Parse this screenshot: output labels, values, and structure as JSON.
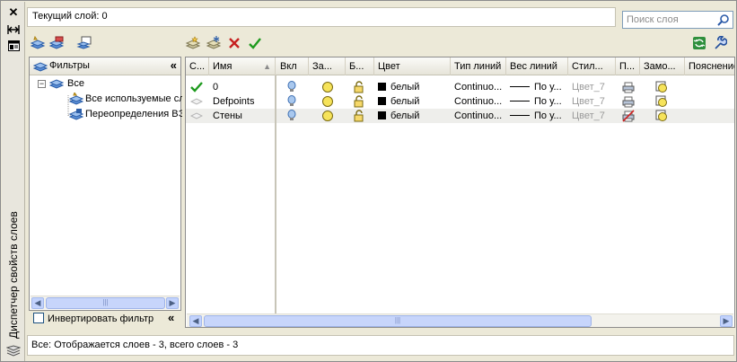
{
  "palette_title": "Диспетчер свойств слоев",
  "current_layer": "Текущий слой: 0",
  "search": {
    "placeholder": "Поиск слоя"
  },
  "filters": {
    "header": "Фильтры",
    "tree": [
      {
        "label": "Все",
        "level": 0
      },
      {
        "label": "Все используемые сл",
        "level": 1
      },
      {
        "label": "Переопределения ВЭ",
        "level": 1
      }
    ],
    "invert_label": "Инвертировать фильтр"
  },
  "columns": [
    "С...",
    "Имя",
    "Вкл",
    "За...",
    "Б...",
    "Цвет",
    "Тип линий",
    "Вес линий",
    "Стил...",
    "П...",
    "Замо...",
    "Пояснение"
  ],
  "layers": [
    {
      "name": "0",
      "current": true,
      "color": "белый",
      "linetype": "Continuo...",
      "lineweight": "По у...",
      "plot_style": "Цвет_7",
      "plot": true
    },
    {
      "name": "Defpoints",
      "current": false,
      "color": "белый",
      "linetype": "Continuo...",
      "lineweight": "По у...",
      "plot_style": "Цвет_7",
      "plot": true
    },
    {
      "name": "Стены",
      "current": false,
      "color": "белый",
      "linetype": "Continuo...",
      "lineweight": "По у...",
      "plot_style": "Цвет_7",
      "plot": false
    }
  ],
  "status": "Все: Отображается слоев - 3, всего слоев - 3",
  "scroll_grip": "|||",
  "icons": {
    "close": "close-icon",
    "auto_hide": "auto-hide-icon",
    "properties": "properties-icon",
    "new_property_filter": "new-property-filter-icon",
    "new_group_filter": "new-group-filter-icon",
    "layer_states": "layer-states-manager-icon",
    "new_layer": "new-layer-icon",
    "new_layer_frozen": "new-layer-vp-frozen-icon",
    "delete_layer": "delete-layer-icon",
    "set_current": "set-current-icon",
    "refresh": "refresh-icon",
    "settings": "settings-icon"
  }
}
